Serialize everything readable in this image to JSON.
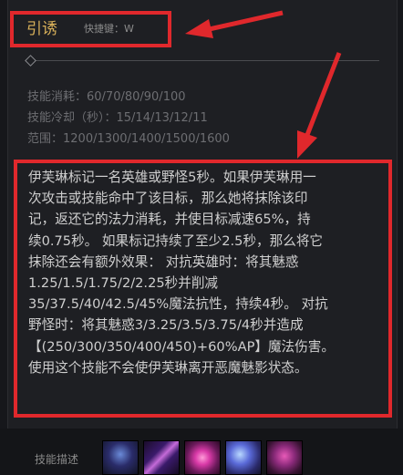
{
  "skill": {
    "name": "引诱",
    "hotkey_label": "快捷键：W"
  },
  "stats": {
    "cost": "技能消耗：60/70/80/90/100",
    "cooldown": "技能冷却（秒）：15/14/13/12/11",
    "range": "范围：1200/1300/1400/1500/1600"
  },
  "description": [
    "伊芙琳标记一名英雄或野怪5秒。如果伊芙琳用一",
    "次攻击或技能命中了该目标，那么她将抹除该印",
    "记，返还它的法力消耗，并使目标减速65%，持",
    "续0.75秒。 如果标记持续了至少2.5秒，那么将它",
    "抹除还会有额外效果： 对抗英雄时：将其魅惑",
    "1.25/1.5/1.75/2/2.25秒并削减",
    "35/37.5/40/42.5/45%魔法抗性，持续4秒。 对抗",
    "野怪时：将其魅惑3/3.25/3.5/3.75/4秒并造成",
    "【(250/300/350/400/450)+60%AP】魔法伤害。",
    "使用这个技能不会使伊芙琳离开恶魔魅影状态。"
  ],
  "footer": {
    "label": "技能描述"
  },
  "skill_icons": [
    "passive-icon",
    "q-skill-icon",
    "w-skill-icon",
    "e-skill-icon",
    "r-skill-icon"
  ],
  "colors": {
    "highlight": "#e0282c",
    "skill_name": "#d9b15a"
  }
}
